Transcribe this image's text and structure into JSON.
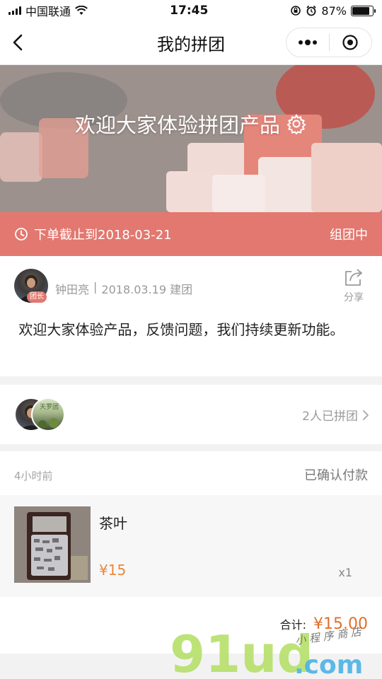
{
  "status_bar": {
    "carrier": "中国联通",
    "time": "17:45",
    "battery_percent": "87%",
    "battery_level": 0.87
  },
  "nav": {
    "title": "我的拼团"
  },
  "banner": {
    "title": "欢迎大家体验拼团产品"
  },
  "deadline": {
    "text": "下单截止到2018-03-21",
    "status": "组团中"
  },
  "leader": {
    "name": "钟田亮",
    "created": "2018.03.19 建团",
    "badge": "团长",
    "share_label": "分享",
    "description": "欢迎大家体验产品，反馈问题，我们持续更新功能。"
  },
  "members": {
    "avatar2_text": "天罗团",
    "count_text": "2人已拼团"
  },
  "order": {
    "time": "4小时前",
    "status": "已确认付款",
    "item": {
      "name": "茶叶",
      "price": "¥15",
      "quantity": "x1"
    },
    "total_label": "合计:",
    "total_value": "¥15.00"
  },
  "watermark": {
    "brand": "91ud",
    "suffix": ".com",
    "tagline": "小程序商店"
  },
  "colors": {
    "accent": "#e2786f",
    "price": "#e8883c"
  }
}
